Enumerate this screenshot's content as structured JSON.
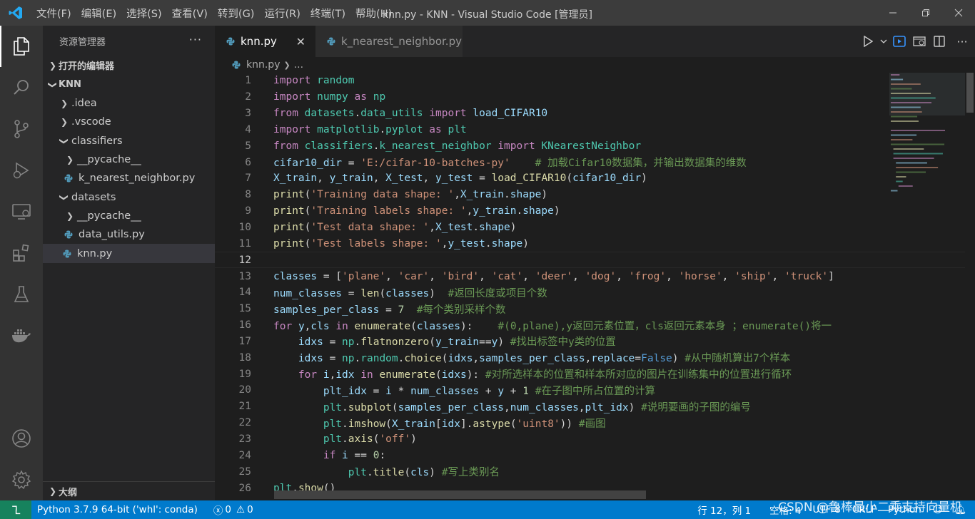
{
  "window": {
    "title": "knn.py - KNN - Visual Studio Code [管理员]"
  },
  "menu": [
    "文件(F)",
    "编辑(E)",
    "选择(S)",
    "查看(V)",
    "转到(G)",
    "运行(R)",
    "终端(T)",
    "帮助(H)"
  ],
  "sidebar": {
    "title": "资源管理器",
    "open_editors": "打开的编辑器",
    "root": "KNN",
    "items": [
      {
        "label": ".idea",
        "type": "folder",
        "depth": 1,
        "expanded": false
      },
      {
        "label": ".vscode",
        "type": "folder",
        "depth": 1,
        "expanded": false
      },
      {
        "label": "classifiers",
        "type": "folder",
        "depth": 1,
        "expanded": true
      },
      {
        "label": "__pycache__",
        "type": "folder",
        "depth": 2,
        "expanded": false
      },
      {
        "label": "k_nearest_neighbor.py",
        "type": "python-file",
        "depth": 2
      },
      {
        "label": "datasets",
        "type": "folder",
        "depth": 1,
        "expanded": true
      },
      {
        "label": "__pycache__",
        "type": "folder",
        "depth": 2,
        "expanded": false
      },
      {
        "label": "data_utils.py",
        "type": "python-file",
        "depth": 2
      },
      {
        "label": "knn.py",
        "type": "python-file",
        "depth": 1,
        "selected": true
      }
    ],
    "outline": "大纲"
  },
  "tabs": [
    {
      "label": "knn.py",
      "active": true
    },
    {
      "label": "k_nearest_neighbor.py",
      "active": false
    }
  ],
  "breadcrumb": {
    "file": "knn.py",
    "rest": "..."
  },
  "code": {
    "current_line": 12,
    "lines": [
      "import random",
      "import numpy as np",
      "from datasets.data_utils import load_CIFAR10",
      "import matplotlib.pyplot as plt",
      "from classifiers.k_nearest_neighbor import KNearestNeighbor",
      "cifar10_dir = 'E:/cifar-10-batches-py'    # 加载Cifar10数据集，并输出数据集的维数",
      "X_train, y_train, X_test, y_test = load_CIFAR10(cifar10_dir)",
      "print('Training data shape: ',X_train.shape)",
      "print('Training labels shape: ',y_train.shape)",
      "print('Test data shape: ',X_test.shape)",
      "print('Test labels shape: ',y_test.shape)",
      "",
      "classes = ['plane', 'car', 'bird', 'cat', 'deer', 'dog', 'frog', 'horse', 'ship', 'truck']",
      "num_classes = len(classes)  #返回长度或项目个数",
      "samples_per_class = 7  #每个类别采样个数",
      "for y,cls in enumerate(classes):    #(0,plane),y返回元素位置，cls返回元素本身 ；enumerate()将一",
      "    idxs = np.flatnonzero(y_train==y) #找出标签中y类的位置",
      "    idxs = np.random.choice(idxs,samples_per_class,replace=False) #从中随机算出7个样本",
      "    for i,idx in enumerate(idxs): #对所选样本的位置和样本所对应的图片在训练集中的位置进行循环",
      "        plt_idx = i * num_classes + y + 1 #在子图中所占位置的计算",
      "        plt.subplot(samples_per_class,num_classes,plt_idx) #说明要画的子图的编号",
      "        plt.imshow(X_train[idx].astype('uint8')) #画图",
      "        plt.axis('off')",
      "        if i == 0:",
      "            plt.title(cls) #写上类别名",
      "plt.show()"
    ]
  },
  "status": {
    "interpreter": "Python 3.7.9 64-bit ('whl': conda)",
    "errors": "0",
    "warnings": "0",
    "position": "行 12，列 1",
    "spaces": "空格: 4",
    "encoding": "UTF-8",
    "eol": "CRLF",
    "language": "Python"
  },
  "watermark": "CSDN @鲁棒最小二乘支持向量机"
}
